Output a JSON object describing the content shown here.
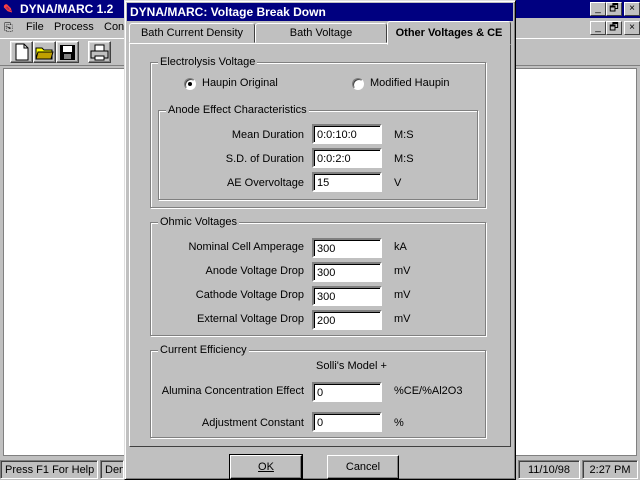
{
  "app": {
    "title": "DYNA/MARC 1.2",
    "menu": [
      {
        "label": "File",
        "accel": "F"
      },
      {
        "label": "Process",
        "accel": "P"
      },
      {
        "label": "Con",
        "accel": "C"
      }
    ],
    "caption_buttons": [
      "_",
      "🗗",
      "×"
    ],
    "status": {
      "help": "Press F1 For Help",
      "mode": "Den",
      "date": "11/10/98",
      "time": "2:27 PM"
    }
  },
  "dialog": {
    "title": "DYNA/MARC: Voltage Break Down",
    "tabs": [
      "Bath Current Density",
      "Bath Voltage",
      "Other Voltages & CE"
    ],
    "active_tab": 2,
    "electrolysis": {
      "legend": "Electrolysis Voltage",
      "options": [
        "Haupin Original",
        "Modified Haupin"
      ],
      "selected": 0
    },
    "anode": {
      "legend": "Anode Effect Characteristics",
      "rows": [
        {
          "label": "Mean Duration",
          "value": "0:0:10:0",
          "unit": "M:S"
        },
        {
          "label": "S.D. of Duration",
          "value": "0:0:2:0",
          "unit": "M:S"
        },
        {
          "label": "AE Overvoltage",
          "value": "15",
          "unit": "V"
        }
      ]
    },
    "ohmic": {
      "legend": "Ohmic Voltages",
      "rows": [
        {
          "label": "Nominal Cell Amperage",
          "value": "300",
          "unit": "kA"
        },
        {
          "label": "Anode Voltage Drop",
          "value": "300",
          "unit": "mV"
        },
        {
          "label": "Cathode Voltage Drop",
          "value": "300",
          "unit": "mV"
        },
        {
          "label": "External Voltage Drop",
          "value": "200",
          "unit": "mV"
        }
      ]
    },
    "ce": {
      "legend": "Current Efficiency",
      "model": "Solli's Model +",
      "rows": [
        {
          "label": "Alumina Concentration Effect",
          "value": "0",
          "unit": "%CE/%Al2O3"
        },
        {
          "label": "Adjustment Constant",
          "value": "0",
          "unit": "%"
        }
      ]
    },
    "buttons": {
      "ok": "OK",
      "cancel": "Cancel"
    }
  }
}
